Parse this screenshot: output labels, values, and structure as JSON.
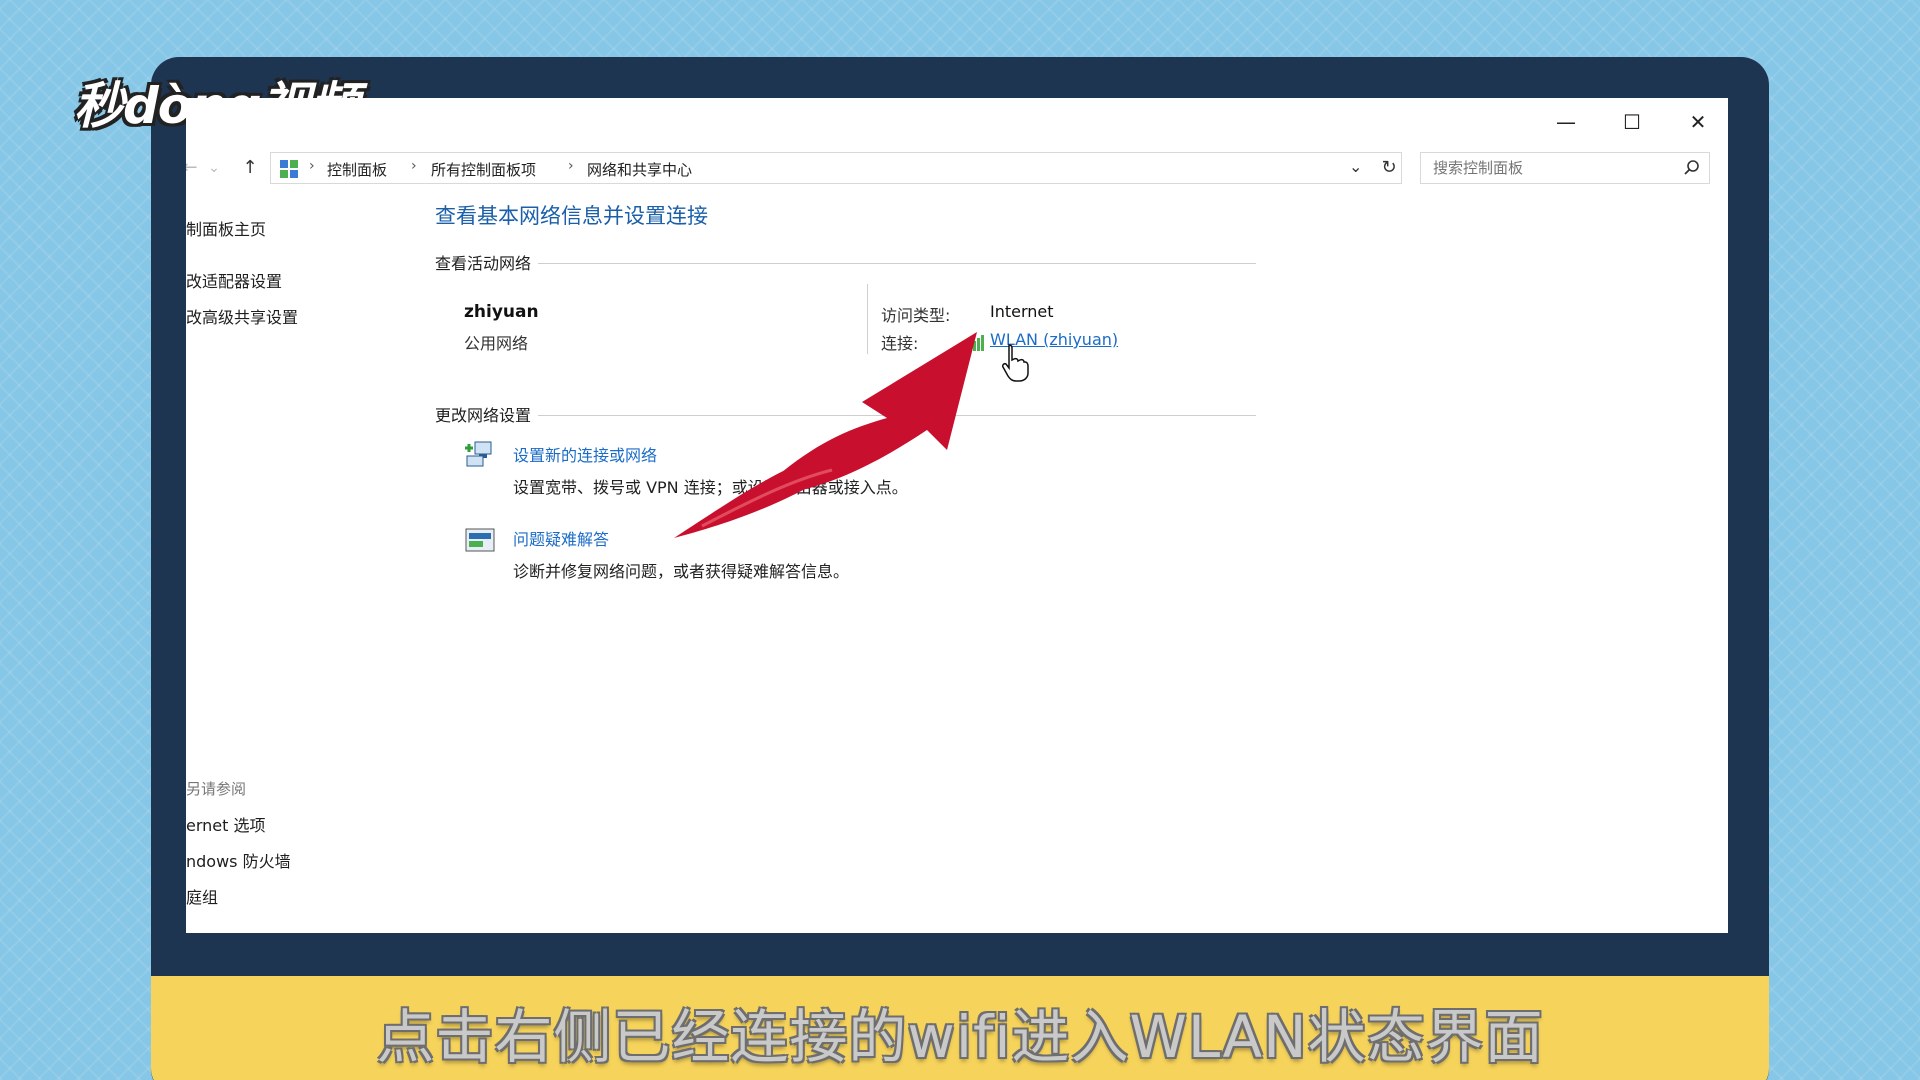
{
  "logo": {
    "text": "秒dòng视频"
  },
  "window": {
    "controls": {
      "minimize": "—",
      "maximize": "☐",
      "close": "✕"
    }
  },
  "address_bar": {
    "back": "←",
    "dropdown": "⌄",
    "up": "↑",
    "breadcrumb": [
      "控制面板",
      "所有控制面板项",
      "网络和共享中心"
    ],
    "separator": "›",
    "history_arrow": "⌄",
    "refresh": "↻"
  },
  "search": {
    "placeholder": "搜索控制面板"
  },
  "left_pane": {
    "links": [
      "制面板主页",
      "改适配器设置",
      "改高级共享设置"
    ],
    "see_also_header": "另请参阅",
    "see_also": [
      "ernet 选项",
      "ndows 防火墙",
      "庭组"
    ]
  },
  "main": {
    "title": "查看基本网络信息并设置连接",
    "active_networks_header": "查看活动网络",
    "network": {
      "name": "zhiyuan",
      "type": "公用网络",
      "access_type_label": "访问类型:",
      "access_type_value": "Internet",
      "connection_label": "连接:",
      "connection_value": "WLAN (zhiyuan)"
    },
    "change_settings_header": "更改网络设置",
    "actions": [
      {
        "label": "设置新的连接或网络",
        "desc": "设置宽带、拨号或 VPN 连接；或设置路由器或接入点。",
        "icon": "network-setup-icon"
      },
      {
        "label": "问题疑难解答",
        "desc": "诊断并修复网络问题，或者获得疑难解答信息。",
        "icon": "troubleshoot-icon"
      }
    ]
  },
  "colors": {
    "link": "#1b6cc7",
    "title": "#1b5fa8",
    "bezel": "#1e3552",
    "caption_bar": "#f6d35b",
    "arrow": "#c8102e"
  },
  "caption": "点击右侧已经连接的wifi进入WLAN状态界面"
}
